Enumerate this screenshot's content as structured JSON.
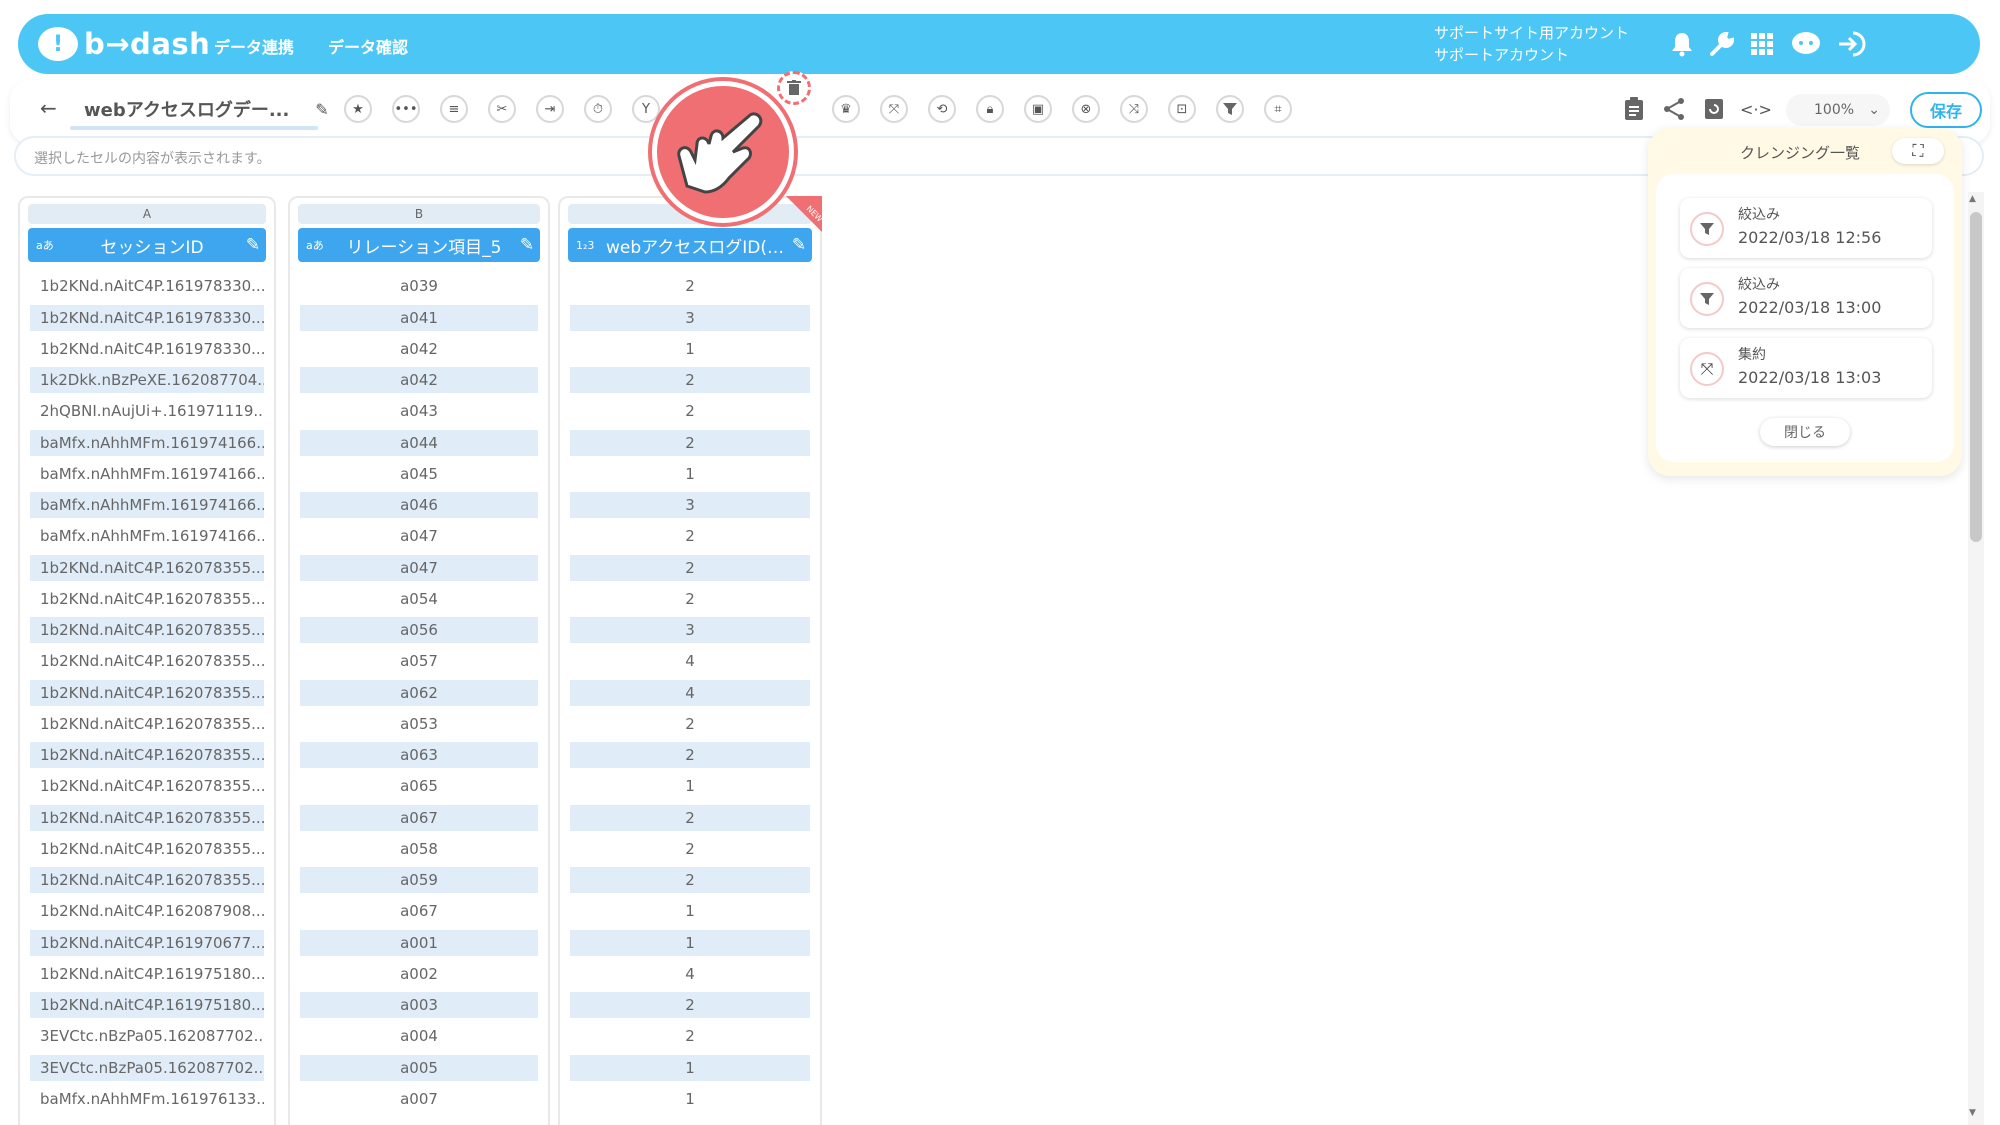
{
  "header": {
    "brand": "b→dash",
    "nav": [
      "データ連携",
      "データ確認"
    ],
    "account_line1": "サポートサイト用アカウント",
    "account_line2": "サポートアカウント",
    "icons": [
      "bell-icon",
      "wrench-icon",
      "grid-icon",
      "chat-icon",
      "logout-icon"
    ]
  },
  "toolbar": {
    "back": "←",
    "title": "webアクセスログデー...",
    "zoom": "100%",
    "save_label": "保存"
  },
  "cellbar": {
    "placeholder": "選択したセルの内容が表示されます。"
  },
  "table": {
    "columns": [
      {
        "letter": "A",
        "type": "aあ",
        "name": "セッションID"
      },
      {
        "letter": "B",
        "type": "aあ",
        "name": "リレーション項目_5"
      },
      {
        "letter": "",
        "type": "1₂3",
        "name": "webアクセスログID(…"
      }
    ],
    "badge": "NEW",
    "rows": [
      [
        "1b2KNd.nAitC4P.161978330...",
        "a039",
        "2"
      ],
      [
        "1b2KNd.nAitC4P.161978330...",
        "a041",
        "3"
      ],
      [
        "1b2KNd.nAitC4P.161978330...",
        "a042",
        "1"
      ],
      [
        "1k2Dkk.nBzPeXE.162087704...",
        "a042",
        "2"
      ],
      [
        "2hQBNI.nAujUi+.161971119...",
        "a043",
        "2"
      ],
      [
        "baMfx.nAhhMFm.161974166...",
        "a044",
        "2"
      ],
      [
        "baMfx.nAhhMFm.161974166...",
        "a045",
        "1"
      ],
      [
        "baMfx.nAhhMFm.161974166...",
        "a046",
        "3"
      ],
      [
        "baMfx.nAhhMFm.161974166...",
        "a047",
        "2"
      ],
      [
        "1b2KNd.nAitC4P.162078355...",
        "a047",
        "2"
      ],
      [
        "1b2KNd.nAitC4P.162078355...",
        "a054",
        "2"
      ],
      [
        "1b2KNd.nAitC4P.162078355...",
        "a056",
        "3"
      ],
      [
        "1b2KNd.nAitC4P.162078355...",
        "a057",
        "4"
      ],
      [
        "1b2KNd.nAitC4P.162078355...",
        "a062",
        "4"
      ],
      [
        "1b2KNd.nAitC4P.162078355...",
        "a053",
        "2"
      ],
      [
        "1b2KNd.nAitC4P.162078355...",
        "a063",
        "2"
      ],
      [
        "1b2KNd.nAitC4P.162078355...",
        "a065",
        "1"
      ],
      [
        "1b2KNd.nAitC4P.162078355...",
        "a067",
        "2"
      ],
      [
        "1b2KNd.nAitC4P.162078355...",
        "a058",
        "2"
      ],
      [
        "1b2KNd.nAitC4P.162078355...",
        "a059",
        "2"
      ],
      [
        "1b2KNd.nAitC4P.162087908...",
        "a067",
        "1"
      ],
      [
        "1b2KNd.nAitC4P.161970677...",
        "a001",
        "1"
      ],
      [
        "1b2KNd.nAitC4P.161975180...",
        "a002",
        "4"
      ],
      [
        "1b2KNd.nAitC4P.161975180...",
        "a003",
        "2"
      ],
      [
        "3EVCtc.nBzPa05.162087702...",
        "a004",
        "2"
      ],
      [
        "3EVCtc.nBzPa05.162087702...",
        "a005",
        "1"
      ],
      [
        "baMfx.nAhhMFm.161976133...",
        "a007",
        "1"
      ]
    ]
  },
  "panel": {
    "title": "クレンジング一覧",
    "history": [
      {
        "label": "絞込み",
        "time": "2022/03/18 12:56",
        "icon": "filter-icon"
      },
      {
        "label": "絞込み",
        "time": "2022/03/18 13:00",
        "icon": "filter-icon"
      },
      {
        "label": "集約",
        "time": "2022/03/18 13:03",
        "icon": "aggregate-icon"
      }
    ],
    "close_label": "閉じる"
  },
  "colors": {
    "header_bg": "#4cc6f5",
    "column_head": "#3da6ee",
    "row_alt": "#e0edf8",
    "accent_pink": "#ef6f72",
    "panel_bg": "#fff9e6"
  }
}
